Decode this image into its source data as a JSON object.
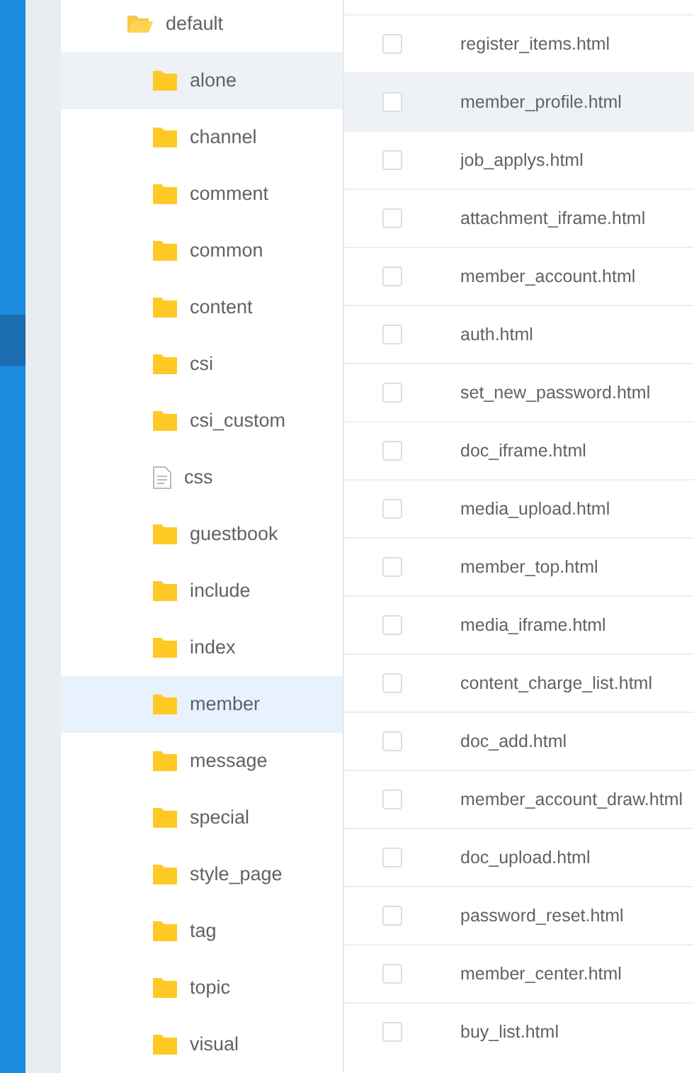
{
  "tree": [
    {
      "label": "default",
      "kind": "folder",
      "expanded": true,
      "selected": false,
      "hovered": false,
      "children": [
        {
          "label": "alone",
          "kind": "folder",
          "selected": false,
          "hovered": true
        },
        {
          "label": "channel",
          "kind": "folder",
          "selected": false,
          "hovered": false
        },
        {
          "label": "comment",
          "kind": "folder",
          "selected": false,
          "hovered": false
        },
        {
          "label": "common",
          "kind": "folder",
          "selected": false,
          "hovered": false
        },
        {
          "label": "content",
          "kind": "folder",
          "selected": false,
          "hovered": false
        },
        {
          "label": "csi",
          "kind": "folder",
          "selected": false,
          "hovered": false
        },
        {
          "label": "csi_custom",
          "kind": "folder",
          "selected": false,
          "hovered": false
        },
        {
          "label": "css",
          "kind": "file",
          "selected": false,
          "hovered": false
        },
        {
          "label": "guestbook",
          "kind": "folder",
          "selected": false,
          "hovered": false
        },
        {
          "label": "include",
          "kind": "folder",
          "selected": false,
          "hovered": false
        },
        {
          "label": "index",
          "kind": "folder",
          "selected": false,
          "hovered": false
        },
        {
          "label": "member",
          "kind": "folder",
          "selected": true,
          "hovered": false
        },
        {
          "label": "message",
          "kind": "folder",
          "selected": false,
          "hovered": false
        },
        {
          "label": "special",
          "kind": "folder",
          "selected": false,
          "hovered": false
        },
        {
          "label": "style_page",
          "kind": "folder",
          "selected": false,
          "hovered": false
        },
        {
          "label": "tag",
          "kind": "folder",
          "selected": false,
          "hovered": false
        },
        {
          "label": "topic",
          "kind": "folder",
          "selected": false,
          "hovered": false
        },
        {
          "label": "visual",
          "kind": "folder",
          "selected": false,
          "hovered": false
        }
      ]
    }
  ],
  "files": [
    {
      "name": "register_items.html",
      "checked": false,
      "hovered": false
    },
    {
      "name": "member_profile.html",
      "checked": false,
      "hovered": true
    },
    {
      "name": "job_applys.html",
      "checked": false,
      "hovered": false
    },
    {
      "name": "attachment_iframe.html",
      "checked": false,
      "hovered": false
    },
    {
      "name": "member_account.html",
      "checked": false,
      "hovered": false
    },
    {
      "name": "auth.html",
      "checked": false,
      "hovered": false
    },
    {
      "name": "set_new_password.html",
      "checked": false,
      "hovered": false
    },
    {
      "name": "doc_iframe.html",
      "checked": false,
      "hovered": false
    },
    {
      "name": "media_upload.html",
      "checked": false,
      "hovered": false
    },
    {
      "name": "member_top.html",
      "checked": false,
      "hovered": false
    },
    {
      "name": "media_iframe.html",
      "checked": false,
      "hovered": false
    },
    {
      "name": "content_charge_list.html",
      "checked": false,
      "hovered": false
    },
    {
      "name": "doc_add.html",
      "checked": false,
      "hovered": false
    },
    {
      "name": "member_account_draw.html",
      "checked": false,
      "hovered": false
    },
    {
      "name": "doc_upload.html",
      "checked": false,
      "hovered": false
    },
    {
      "name": "password_reset.html",
      "checked": false,
      "hovered": false
    },
    {
      "name": "member_center.html",
      "checked": false,
      "hovered": false
    },
    {
      "name": "buy_list.html",
      "checked": false,
      "hovered": false
    }
  ]
}
